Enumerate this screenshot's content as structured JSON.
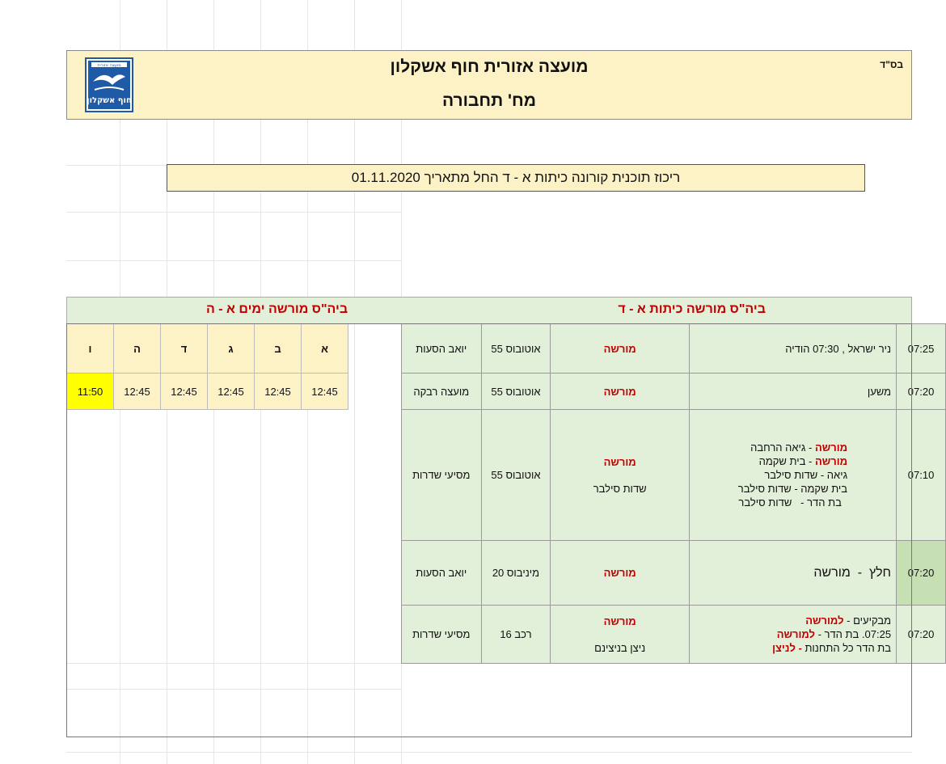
{
  "header": {
    "corner_text": "בס\"ד",
    "title": "מועצה אזורית חוף אשקלון",
    "department": "מח' תחבורה",
    "logo_text": "חוף אשקלון",
    "logo_top_text": "מועצה אזורית"
  },
  "subtitle": "ריכוז תוכנית קורונה כיתות א - ד החל מתאריך 01.11.2020",
  "band": {
    "right_label": "ביה\"ס מורשה   כיתות  א - ד",
    "left_label": "ביה\"ס מורשה   ימים א - ה"
  },
  "days_table": {
    "headers": [
      "א",
      "ב",
      "ג",
      "ד",
      "ה",
      "ו"
    ],
    "values": [
      "12:45",
      "12:45",
      "12:45",
      "12:45",
      "12:45",
      "11:50"
    ],
    "highlight_color": "#ffff00"
  },
  "schedule": {
    "rows": [
      {
        "time": "07:25",
        "route": [
          "ניר ישראל , 07:30 הודיה"
        ],
        "school": "מורשה",
        "school_sub": "",
        "vehicle": "אוטובוס 55",
        "company": "יואב הסעות"
      },
      {
        "time": "07:20",
        "route": [
          "משען"
        ],
        "school": "מורשה",
        "school_sub": "",
        "vehicle": "אוטובוס 55",
        "company": "מועצה רבקה"
      },
      {
        "time": "07:10",
        "route_lines": [
          {
            "red": "מורשה",
            "rest": " - גיאה הרחבה"
          },
          {
            "red": "מורשה",
            "rest": " - בית שקמה"
          },
          {
            "red": "",
            "rest": "גיאה - שדות סילבר"
          },
          {
            "red": "",
            "rest": "בית שקמה -  שדות סילבר"
          },
          {
            "red": "",
            "rest": "  בת הדר -   שדות סילבר"
          }
        ],
        "school": "מורשה",
        "school_sub": "שדות סילבר",
        "vehicle": "אוטובוס 55",
        "company": "מסיעי שדרות"
      },
      {
        "time": "07:20",
        "route": [
          "חלץ  -  מורשה"
        ],
        "school": "מורשה",
        "school_sub": "",
        "vehicle": "מיניבוס 20",
        "company": "יואב הסעות"
      },
      {
        "time": "07:20",
        "route_lines": [
          {
            "pre": "מבקיעים - ",
            "red": "למורשה",
            "post": ""
          },
          {
            "pre": "07:25.  בת הדר - ",
            "red": "למורשה",
            "post": ""
          },
          {
            "pre": "בת הדר כל התחנות ",
            "red": "- לניצן",
            "post": ""
          }
        ],
        "school": "מורשה",
        "school_sub": "ניצן בניצינם",
        "vehicle": "רכב 16",
        "company": "מסיעי שדרות"
      }
    ]
  },
  "colors": {
    "header_bg": "#fdf1c6",
    "schedule_bg": "#e2efd9",
    "accent_red": "#c00000",
    "logo_blue": "#1f5aa6"
  }
}
